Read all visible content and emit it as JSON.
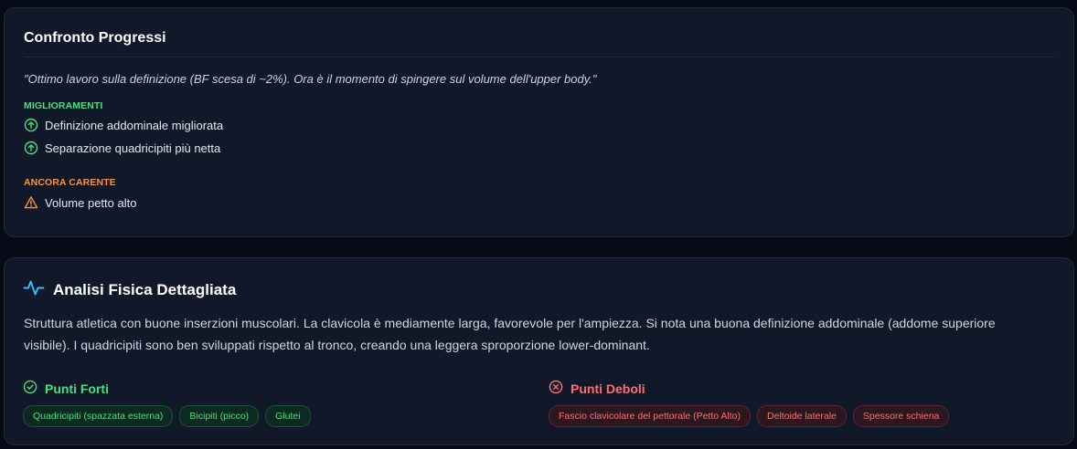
{
  "progress": {
    "title": "Confronto Progressi",
    "quote": "\"Ottimo lavoro sulla definizione (BF scesa di ~2%). Ora è il momento di spingere sul volume dell'upper body.\"",
    "improvements_label": "MIGLIORAMENTI",
    "improvements": [
      "Definizione addominale migliorata",
      "Separazione quadricipiti più netta"
    ],
    "lacking_label": "ANCORA CARENTE",
    "lacking": [
      "Volume petto alto"
    ]
  },
  "analysis": {
    "title": "Analisi Fisica Dettagliata",
    "description": "Struttura atletica con buone inserzioni muscolari. La clavicola è mediamente larga, favorevole per l'ampiezza. Si nota una buona definizione addominale (addome superiore visibile). I quadricipiti sono ben sviluppati rispetto al tronco, creando una leggera sproporzione lower-dominant.",
    "strengths_label": "Punti Forti",
    "strengths": [
      "Quadricipiti (spazzata esterna)",
      "Bicipiti (picco)",
      "Glutei"
    ],
    "weaknesses_label": "Punti Deboli",
    "weaknesses": [
      "Fascio clavicolare del pettorale (Petto Alto)",
      "Deltoide laterale",
      "Spessore schiena"
    ]
  },
  "colors": {
    "background": "#070b16",
    "card": "#101829",
    "positive": "#4ade80",
    "warning": "#fb923c",
    "negative": "#f87171",
    "accent": "#38bdf8"
  },
  "icons": {
    "improvement": "arrow-up-circle-icon",
    "lacking": "warning-triangle-icon",
    "analysis": "activity-pulse-icon",
    "strengths": "check-circle-icon",
    "weaknesses": "x-circle-icon"
  }
}
